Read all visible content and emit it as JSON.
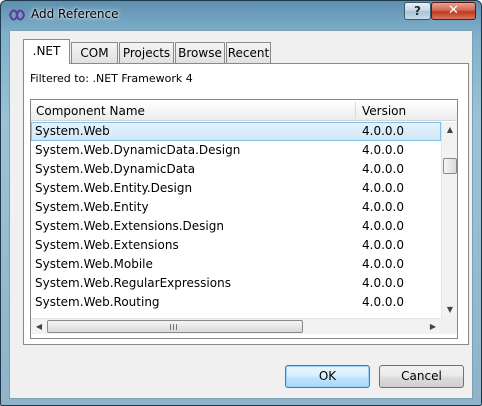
{
  "window": {
    "title": "Add Reference",
    "help_label": "?",
    "close_label": "✕"
  },
  "tabs": [
    {
      "label": ".NET",
      "active": true
    },
    {
      "label": "COM",
      "active": false
    },
    {
      "label": "Projects",
      "active": false
    },
    {
      "label": "Browse",
      "active": false
    },
    {
      "label": "Recent",
      "active": false
    }
  ],
  "filter_text": "Filtered to: .NET Framework 4",
  "list": {
    "columns": [
      "Component Name",
      "Version"
    ],
    "rows": [
      {
        "name": "System.Web",
        "version": "4.0.0.0",
        "selected": true
      },
      {
        "name": "System.Web.DynamicData.Design",
        "version": "4.0.0.0"
      },
      {
        "name": "System.Web.DynamicData",
        "version": "4.0.0.0"
      },
      {
        "name": "System.Web.Entity.Design",
        "version": "4.0.0.0"
      },
      {
        "name": "System.Web.Entity",
        "version": "4.0.0.0"
      },
      {
        "name": "System.Web.Extensions.Design",
        "version": "4.0.0.0"
      },
      {
        "name": "System.Web.Extensions",
        "version": "4.0.0.0"
      },
      {
        "name": "System.Web.Mobile",
        "version": "4.0.0.0"
      },
      {
        "name": "System.Web.RegularExpressions",
        "version": "4.0.0.0"
      },
      {
        "name": "System.Web.Routing",
        "version": "4.0.0.0"
      }
    ]
  },
  "scroll": {
    "up": "▲",
    "down": "▼",
    "left": "◀",
    "right": "▶"
  },
  "buttons": {
    "ok": "OK",
    "cancel": "Cancel"
  },
  "colors": {
    "selection": "#cfe7f7",
    "default_button": "#3c7fb1"
  }
}
